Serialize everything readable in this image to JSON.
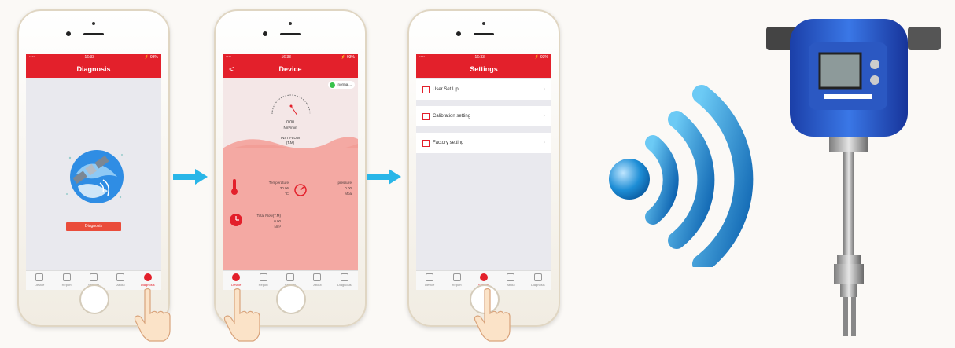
{
  "phone1": {
    "status_left": "•••• ",
    "status_time": "16:33",
    "status_right": "⚡ 93%",
    "title": "Diagnosis",
    "button": "Diagnosis",
    "tabs": [
      "Device",
      "Report",
      "Settings",
      "About",
      "Diagnosis"
    ]
  },
  "phone2": {
    "status_left": "•••• ",
    "status_time": "16:33",
    "status_right": "⚡ 93%",
    "title": "Device",
    "back": "<",
    "status_pill": "normal...",
    "gauge_value": "0.00",
    "gauge_unit": "Nm³/min",
    "gauge_title": "INST FLOW",
    "gauge_sub": "(T.M)",
    "temperature_label": "Temperature",
    "temperature_value": "30.06",
    "temperature_unit": "°C",
    "pressure_label": "pressure",
    "pressure_value": "0.00",
    "pressure_unit": "Mpa",
    "total_label": "Total Flow(T.M)",
    "total_value": "0.00",
    "total_unit": "Nm³",
    "tabs": [
      "Device",
      "Report",
      "Settings",
      "About",
      "Diagnosis"
    ]
  },
  "phone3": {
    "status_left": "•••• ",
    "status_time": "16:33",
    "status_right": "⚡ 93%",
    "title": "Settings",
    "rows": [
      "User Set Up",
      "Calibration setting",
      "Factory setting"
    ],
    "tabs": [
      "Device",
      "Report",
      "Settings",
      "About",
      "Diagnosis"
    ]
  },
  "colors": {
    "accent": "#e3202b",
    "arrow": "#29b6e8",
    "wifi": "#1a8fd4"
  },
  "icons": [
    "globe-satellite-icon",
    "thermometer-icon",
    "pressure-gauge-icon",
    "clock-icon",
    "wifi-signal-icon",
    "pointing-hand-icon",
    "arrow-right-icon"
  ]
}
